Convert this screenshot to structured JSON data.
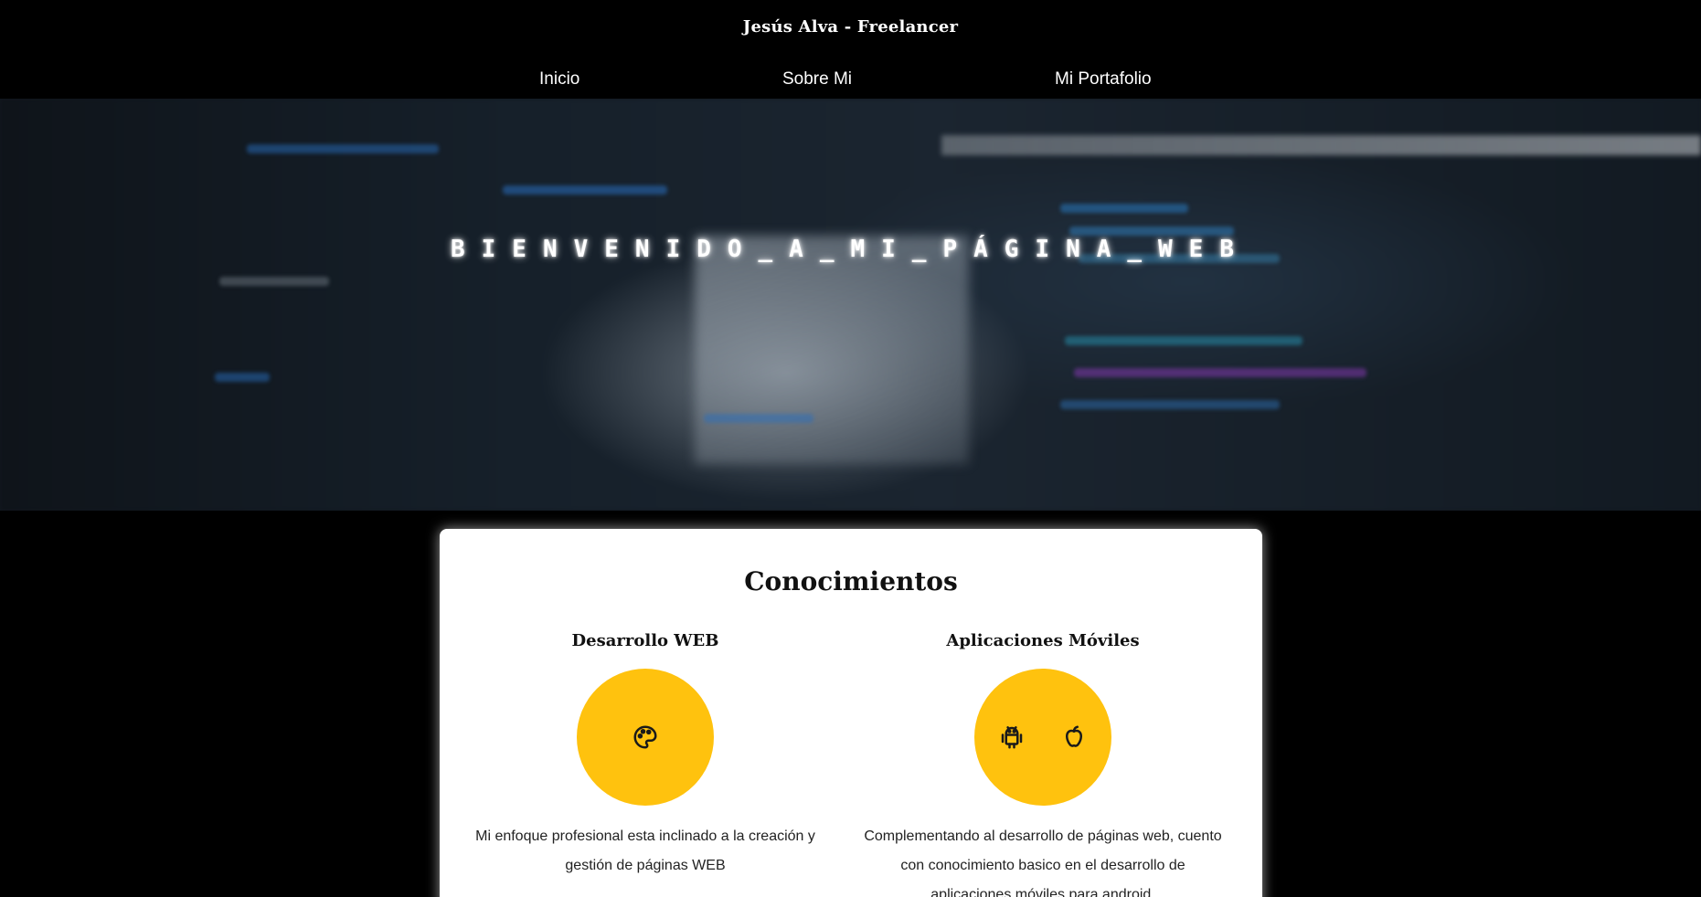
{
  "header": {
    "site_title": "Jesús Alva - Freelancer",
    "nav": [
      {
        "label": "Inicio"
      },
      {
        "label": "Sobre Mi"
      },
      {
        "label": "Mi Portafolio"
      }
    ]
  },
  "hero": {
    "title": "BIENVENIDO_A_MI_PÁGINA_WEB"
  },
  "knowledge": {
    "title": "Conocimientos",
    "items": [
      {
        "title": "Desarrollo WEB",
        "icons": [
          "palette-icon"
        ],
        "description": "Mi enfoque profesional esta inclinado a la creación y gestión de páginas WEB"
      },
      {
        "title": "Aplicaciones Móviles",
        "icons": [
          "android-icon",
          "apple-icon"
        ],
        "description": "Complementando al desarrollo de páginas web, cuento con conocimiento basico en el desarrollo de aplicaciones móviles para android."
      }
    ]
  },
  "colors": {
    "background": "#000000",
    "accent": "#ffc20e",
    "card": "#ffffff",
    "text_light": "#ffffff",
    "text_dark": "#111111"
  }
}
